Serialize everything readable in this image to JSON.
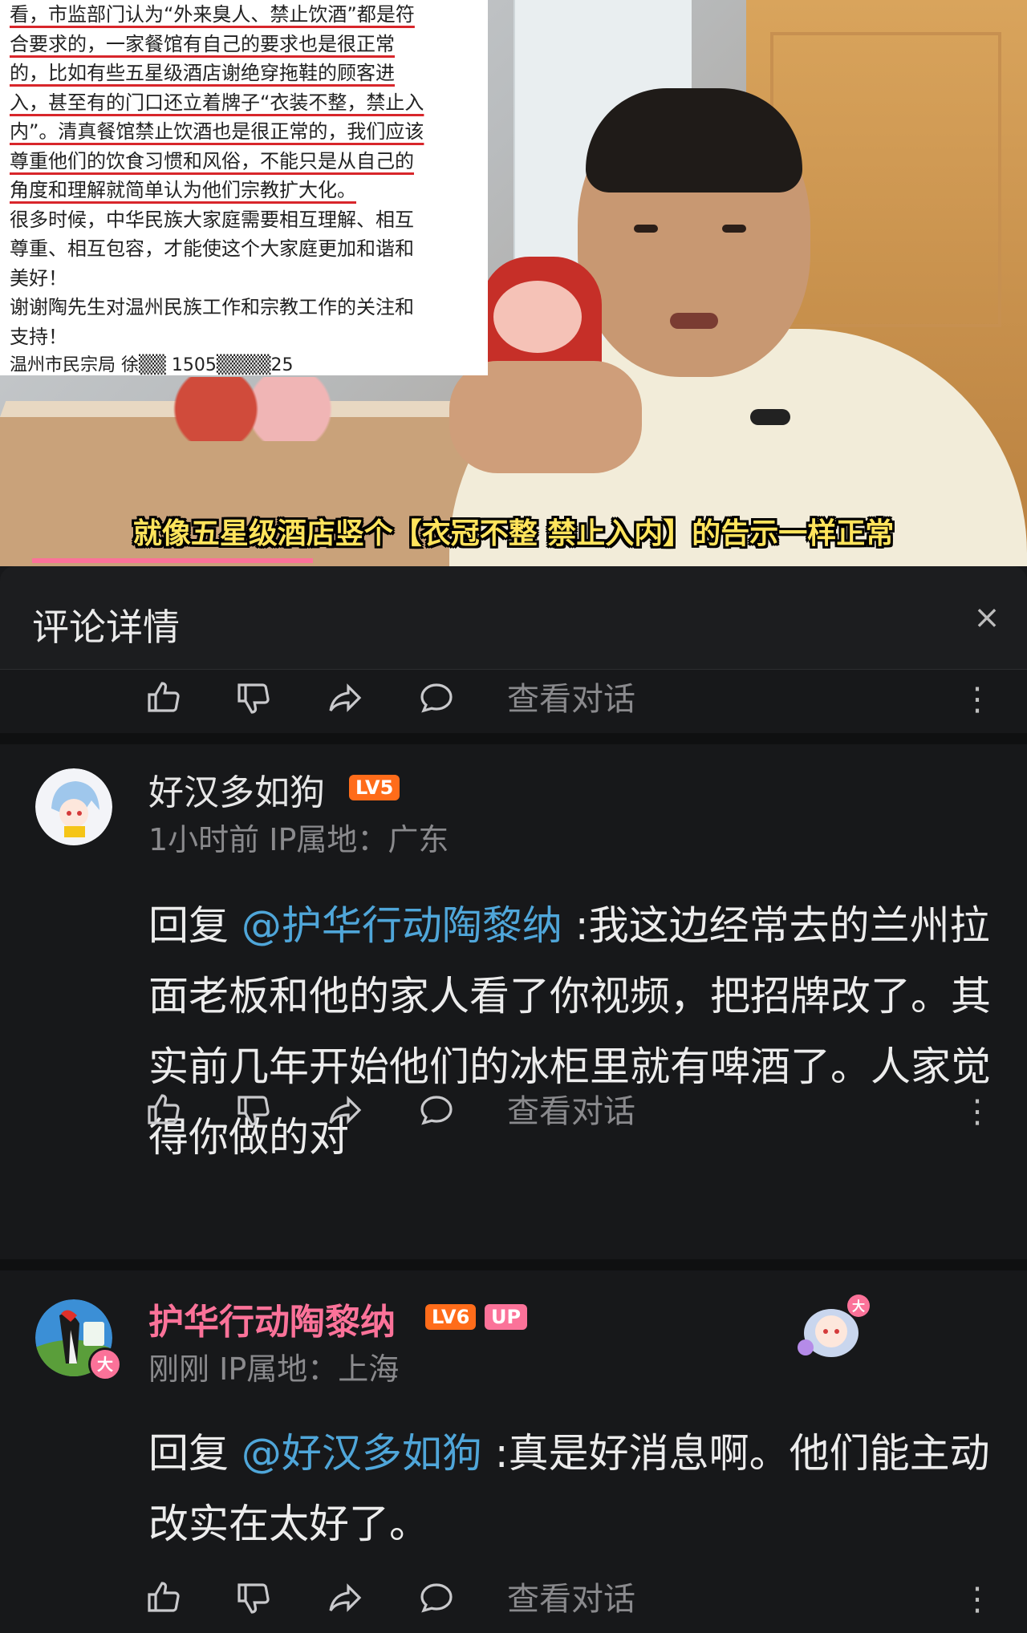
{
  "video": {
    "doc_lines": [
      {
        "text": "看，市监部门认为“外来臭人、禁止饮酒”都是符",
        "hl": true
      },
      {
        "text": "合要求的，一家餐馆有自己的要求也是很正常",
        "hl": true
      },
      {
        "text": "的，比如有些五星级酒店谢绝穿拖鞋的顾客进",
        "hl": true
      },
      {
        "text": "入，甚至有的门口还立着牌子“衣装不整，禁止入",
        "hl": true
      },
      {
        "text": "内”。清真餐馆禁止饮酒也是很正常的，我们应该",
        "hl": true
      },
      {
        "text": "尊重他们的饮食习惯和风俗，不能只是从自己的",
        "hl": true
      },
      {
        "text": "角度和理解就简单认为他们宗教扩大化。",
        "hl": true
      },
      {
        "text": "很多时候，中华民族大家庭需要相互理解、相互",
        "hl": false
      },
      {
        "text": "尊重、相互包容，才能使这个大家庭更加和谐和",
        "hl": false
      },
      {
        "text": "美好！",
        "hl": false
      },
      {
        "text": "谢谢陶先生对温州民族工作和宗教工作的关注和",
        "hl": false
      },
      {
        "text": "支持！",
        "hl": false
      }
    ],
    "doc_signature": "温州市民宗局 徐▒▒ 1505▒▒▒▒25",
    "subtitle": "就像五星级酒店竖个【衣冠不整  禁止入内】的告示一样正常"
  },
  "panel": {
    "title": "评论详情",
    "close_icon": "×"
  },
  "actions": {
    "view_conversation": "查看对话",
    "more": "⋮"
  },
  "comments": [
    {
      "username": "好汉多如狗",
      "level": "LV5",
      "time": "1小时前",
      "ip": "IP属地：广东",
      "reply_prefix": "回复 ",
      "mention": "@护华行动陶黎纳",
      "text": " :我这边经常去的兰州拉面老板和他的家人看了你视频，把招牌改了。其实前几年开始他们的冰柜里就有啤酒了。人家觉得你做的对"
    },
    {
      "username": "护华行动陶黎纳",
      "level": "LV6",
      "badge": "UP",
      "time": "刚刚",
      "ip": "IP属地：上海",
      "reply_prefix": "回复 ",
      "mention": "@好汉多如狗",
      "text": " :真是好消息啊。他们能主动改实在太好了。"
    }
  ],
  "colors": {
    "accent_pink": "#fb7299",
    "mention_blue": "#4fa6d9",
    "level_orange": "#ff6c1a",
    "up_name": "#fb7299"
  }
}
